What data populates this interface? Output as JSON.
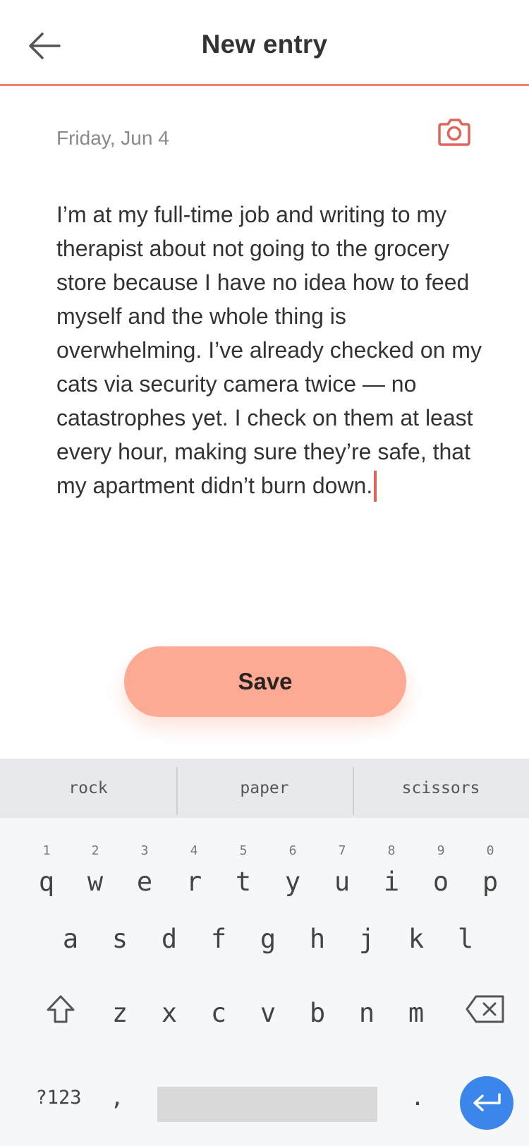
{
  "header": {
    "title": "New entry",
    "back_icon": "arrow-left-icon"
  },
  "entry": {
    "date": "Friday, Jun 4",
    "camera_icon": "camera-icon",
    "text": "I’m at my full-time job and writing to my therapist about not going to the grocery store because I have no idea how to feed myself and the whole thing is overwhelming. I’ve already checked on my cats via security camera twice — no catastrophes yet. I check on them at least every hour, making sure they’re safe, that my apartment didn’t burn down."
  },
  "save": {
    "label": "Save"
  },
  "keyboard": {
    "suggestions": [
      "rock",
      "paper",
      "scissors"
    ],
    "row1": [
      {
        "hint": "1",
        "key": "q"
      },
      {
        "hint": "2",
        "key": "w"
      },
      {
        "hint": "3",
        "key": "e"
      },
      {
        "hint": "4",
        "key": "r"
      },
      {
        "hint": "5",
        "key": "t"
      },
      {
        "hint": "6",
        "key": "y"
      },
      {
        "hint": "7",
        "key": "u"
      },
      {
        "hint": "8",
        "key": "i"
      },
      {
        "hint": "9",
        "key": "o"
      },
      {
        "hint": "0",
        "key": "p"
      }
    ],
    "row2": [
      "a",
      "s",
      "d",
      "f",
      "g",
      "h",
      "j",
      "k",
      "l"
    ],
    "row3": [
      "z",
      "x",
      "c",
      "v",
      "b",
      "n",
      "m"
    ],
    "symbols_label": "?123",
    "comma": ",",
    "period": ".",
    "shift_icon": "shift-icon",
    "backspace_icon": "backspace-icon",
    "enter_icon": "enter-icon",
    "colors": {
      "enter": "#3b86eb",
      "accent": "#f2846d",
      "save": "#fdaa95"
    }
  }
}
